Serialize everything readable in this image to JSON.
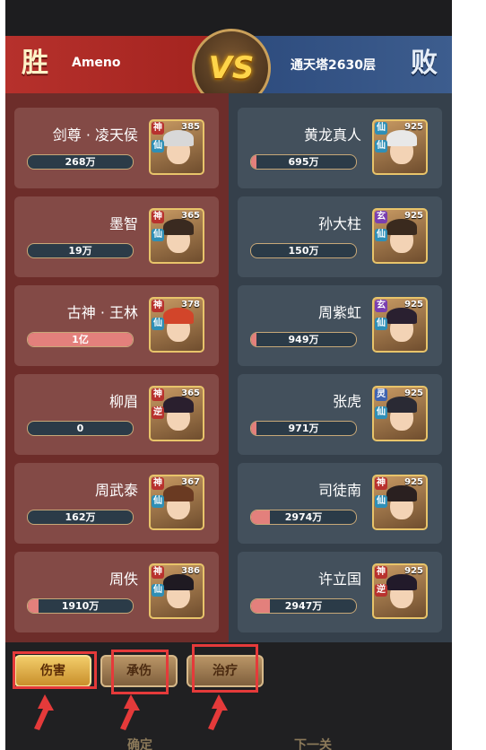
{
  "header": {
    "win_label": "胜",
    "lose_label": "败",
    "vs_label": "VS",
    "left_player": "Ameno",
    "right_player": "通天塔2630层"
  },
  "left_heroes": [
    {
      "name": "剑尊 · 凌天侯",
      "value": "268万",
      "fill": 0.0,
      "level": "385",
      "badges": [
        "神",
        "仙"
      ],
      "hair": "#d8d8d8"
    },
    {
      "name": "墨智",
      "value": "19万",
      "fill": 0.0,
      "level": "365",
      "badges": [
        "神",
        "仙"
      ],
      "hair": "#3a2a20"
    },
    {
      "name": "古神 · 王林",
      "value": "1亿",
      "fill": 1.0,
      "level": "378",
      "badges": [
        "神",
        "仙"
      ],
      "hair": "#d2452a"
    },
    {
      "name": "柳眉",
      "value": "0",
      "fill": 0.0,
      "level": "365",
      "badges": [
        "神",
        "逆"
      ],
      "hair": "#2a1f2e"
    },
    {
      "name": "周武泰",
      "value": "162万",
      "fill": 0.0,
      "level": "367",
      "badges": [
        "神",
        "仙"
      ],
      "hair": "#6a3a22"
    },
    {
      "name": "周佚",
      "value": "1910万",
      "fill": 0.1,
      "level": "386",
      "badges": [
        "神",
        "仙"
      ],
      "hair": "#1f1a22"
    }
  ],
  "right_heroes": [
    {
      "name": "黄龙真人",
      "value": "695万",
      "fill": 0.05,
      "level": "925",
      "badges": [
        "仙",
        "仙"
      ],
      "hair": "#e8e8e8"
    },
    {
      "name": "孙大柱",
      "value": "150万",
      "fill": 0.0,
      "level": "925",
      "badges": [
        "玄",
        "仙"
      ],
      "hair": "#3a2a1e"
    },
    {
      "name": "周紫虹",
      "value": "949万",
      "fill": 0.05,
      "level": "925",
      "badges": [
        "玄",
        "仙"
      ],
      "hair": "#2a2030"
    },
    {
      "name": "张虎",
      "value": "971万",
      "fill": 0.05,
      "level": "925",
      "badges": [
        "灵",
        "仙"
      ],
      "hair": "#2a2a34"
    },
    {
      "name": "司徒南",
      "value": "2974万",
      "fill": 0.18,
      "level": "925",
      "badges": [
        "神",
        "仙"
      ],
      "hair": "#2a2020"
    },
    {
      "name": "许立国",
      "value": "2947万",
      "fill": 0.18,
      "level": "925",
      "badges": [
        "神",
        "逆"
      ],
      "hair": "#221a2a"
    }
  ],
  "tabs": [
    {
      "label": "伤害",
      "active": true
    },
    {
      "label": "承伤",
      "active": false
    },
    {
      "label": "治疗",
      "active": false
    }
  ],
  "footer": {
    "confirm_label": "确定",
    "next_label": "下一关"
  },
  "colors": {
    "win_red": "#b6312c",
    "lose_blue": "#3d5d8e",
    "highlight": "#e53a3a"
  }
}
